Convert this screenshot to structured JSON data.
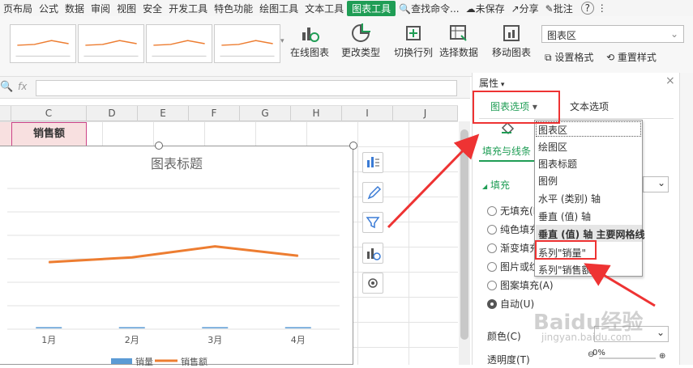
{
  "menubar": {
    "items": [
      "页布局",
      "公式",
      "数据",
      "审阅",
      "视图",
      "安全",
      "开发工具",
      "特色功能",
      "绘图工具",
      "文本工具",
      "图表工具"
    ],
    "search": "查找命令...",
    "unsaved": "未保存",
    "share": "分享",
    "comment": "批注",
    "help": "?"
  },
  "ribbon": {
    "online_chart": "在线图表",
    "change_type": "更改类型",
    "switch_rowcol": "切换行列",
    "select_data": "选择数据",
    "move_chart": "移动图表",
    "chart_area_select": "图表区",
    "set_format": "设置格式",
    "reset_style": "重置样式"
  },
  "formula": {
    "fx": "fx"
  },
  "columns": [
    "C",
    "D",
    "E",
    "F",
    "G",
    "H",
    "I",
    "J"
  ],
  "cell": {
    "sales_header": "销售额"
  },
  "chart_data": {
    "type": "bar+line",
    "title": "图表标题",
    "categories": [
      "1月",
      "2月",
      "3月",
      "4月"
    ],
    "series": [
      {
        "name": "销量",
        "type": "bar",
        "values": [
          0,
          0,
          0,
          0
        ]
      },
      {
        "name": "销售额",
        "type": "line",
        "values": [
          0.42,
          0.45,
          0.52,
          0.46
        ]
      }
    ],
    "colors": {
      "销量": "#5b9bd5",
      "销售额": "#ed7d31"
    },
    "grid": true,
    "legend": "bottom"
  },
  "panel": {
    "title": "属性",
    "tab_chart": "图表选项",
    "tab_text": "文本选项",
    "subtab": "填充与线条",
    "section": "填充",
    "fills": [
      "无填充(N)",
      "纯色填充(S)",
      "渐变填充(G)",
      "图片或纹理填充(P)",
      "图案填充(A)",
      "自动(U)"
    ],
    "color_label": "颜色(C)",
    "transparency_label": "透明度(T)",
    "transparency_val": "0%"
  },
  "dropdown": {
    "items": [
      "图表区",
      "绘图区",
      "图表标题",
      "图例",
      "水平 (类别) 轴",
      "垂直 (值) 轴",
      "垂直 (值) 轴 主要网格线",
      "系列\"销量\"",
      "系列\"销售额\""
    ]
  },
  "watermark": {
    "brand": "Baidu经验",
    "url": "jingyan.baidu.com"
  },
  "colors": {
    "accent": "#1f9d55",
    "red": "#e33333"
  }
}
